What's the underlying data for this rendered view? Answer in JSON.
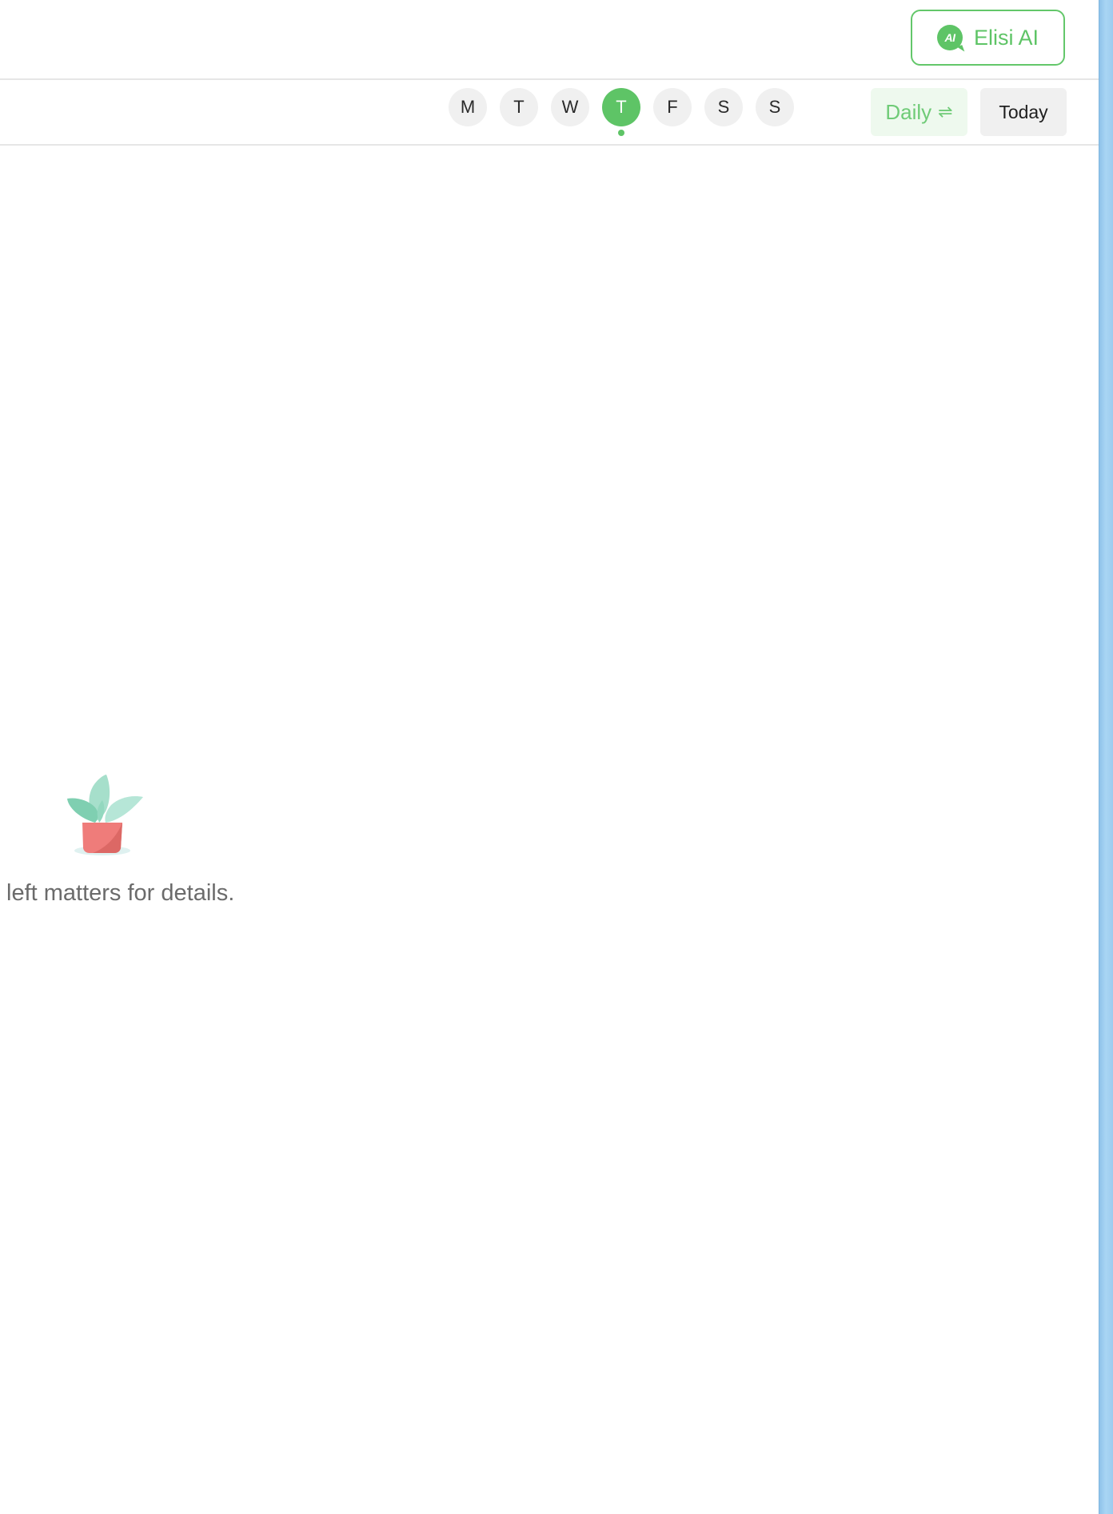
{
  "header": {
    "ai_button": {
      "label": "Elisi AI",
      "badge_text": "AI",
      "accent_color": "#5ec466"
    }
  },
  "toolbar": {
    "week_days": [
      {
        "label": "M",
        "selected": false
      },
      {
        "label": "T",
        "selected": false
      },
      {
        "label": "W",
        "selected": false
      },
      {
        "label": "T",
        "selected": true,
        "today_marker": true
      },
      {
        "label": "F",
        "selected": false
      },
      {
        "label": "S",
        "selected": false
      },
      {
        "label": "S",
        "selected": false
      }
    ],
    "view_mode_label": "Daily",
    "view_mode_icon": "swap-arrows-icon",
    "view_mode_glyph": "⇌",
    "today_label": "Today"
  },
  "empty_state": {
    "illustration": "potted-plant-icon",
    "message": "left matters for details."
  }
}
